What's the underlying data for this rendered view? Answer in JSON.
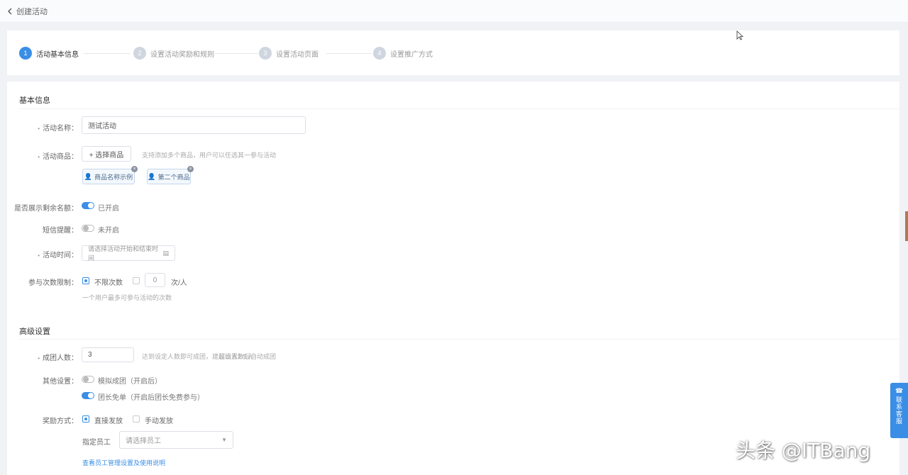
{
  "header": {
    "back_label": "创建活动"
  },
  "steps": [
    {
      "index": "1",
      "label": "活动基本信息",
      "active": true
    },
    {
      "index": "2",
      "label": "设置活动奖励和规则",
      "active": false
    },
    {
      "index": "3",
      "label": "设置活动页面",
      "active": false
    },
    {
      "index": "4",
      "label": "设置推广方式",
      "active": false
    }
  ],
  "basic": {
    "section_title": "基本信息",
    "name": {
      "label": "活动名称：",
      "value": "测试活动"
    },
    "product": {
      "label": "活动商品：",
      "button": "+ 选择商品",
      "hint": "支持添加多个商品，用户可以任选其一参与活动",
      "tags": [
        "商品名称示例",
        "第二个商品"
      ]
    },
    "show_stock": {
      "label": "是否展示剩余名额：",
      "text": "已开启"
    },
    "sms": {
      "label": "短信提醒：",
      "text": "未开启"
    },
    "time": {
      "label": "活动时间：",
      "placeholder": "请选择活动开始和结束时间"
    },
    "limit": {
      "label": "参与次数限制：",
      "opt1": "不限次数",
      "opt2_suffix": "次/人",
      "value": "0",
      "hint": "一个用户最多可参与活动的次数"
    }
  },
  "advanced": {
    "section_title": "高级设置",
    "group_size": {
      "label": "成团人数：",
      "value": "3",
      "hint": "达到设定人数即可成团，建议设置2-5人",
      "hint2": "超出人数后自动成团"
    },
    "options": {
      "label": "其他设置：",
      "opt1": "模拟成团（开启后）",
      "opt2": "团长免单（开启后团长免费参与）"
    },
    "reward": {
      "label": "奖励方式：",
      "opt1": "直接发放",
      "opt2": "手动发放"
    },
    "staff": {
      "label": "指定员工",
      "placeholder": "请选择员工"
    },
    "link": "查看员工管理设置及使用说明"
  },
  "side_tab": {
    "label": "联系客服"
  },
  "watermark": "头条 @ITBang"
}
